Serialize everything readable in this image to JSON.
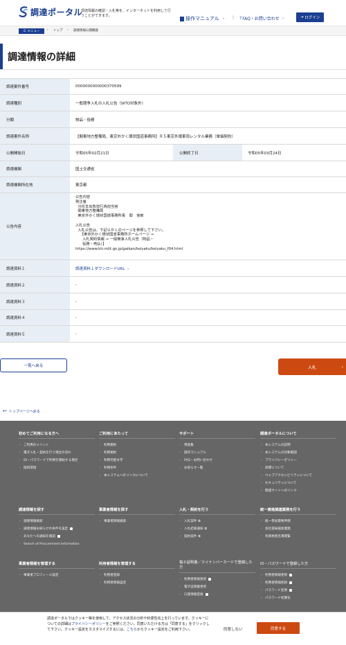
{
  "header": {
    "logo_text": "調達ポータル",
    "tagline": "調達情報の確認・入札等を、インターネットを利用して行うことができます。",
    "manual_link": "操作マニュアル",
    "faq_link": "FAQ・お問い合わせ",
    "login_label": "ログイン"
  },
  "breadcrumb": {
    "menu_label": "メニュー",
    "items": [
      "トップ",
      "調達情報公開機能"
    ]
  },
  "page_title": "調達情報の詳細",
  "detail": {
    "case_number_label": "調達案件番号",
    "case_number": "0000000000000370599",
    "type_label": "調達種別",
    "type": "一般競争入札の入札公告（WTO対象外）",
    "category_label": "分類",
    "category": "物品・役務",
    "name_label": "調達案件名称",
    "name": "【閲東地方整備局、東京外かく環状国道事務所】Ｒ５東京外環車両レンタル業務（単価契約）",
    "start_label": "公開開始日",
    "start": "令和05年02月21日",
    "end_label": "公開終了日",
    "end": "令和05年03月24日",
    "org_label": "調達機関",
    "org": "国土交通省",
    "location_label": "調達機関所在地",
    "location": "東京都",
    "content_label": "公告内容",
    "content": "公告内容\n発注者\n  分任支出負担行為担当官\n  関東地方整備局\n  東京外かく環状国道事務所長　関　信郎\n\n入札公告\n  入札公告は、下記ＵＲＬのページを参照して下さい。\n    【東京外かく環状国道事務所ホームページ →\n      入札契約情報 → 一般競争入札公告（物品・\n      役務・売払）】\nhttps://www.ktr.mlit.go.jp/gaikan/keiyaku/keiyaku_f04.html",
    "doc1_label": "調達資料１",
    "doc1": "調達資料１ダウンロードURL",
    "doc2_label": "調達資料２",
    "doc2": "-",
    "doc3_label": "調達資料３",
    "doc3": "-",
    "doc4_label": "調達資料４",
    "doc4": "-",
    "doc5_label": "調達資料５",
    "doc5": "-"
  },
  "actions": {
    "back_label": "一覧へ戻る",
    "bid_label": "入札",
    "top_link": "トップページへ戻る"
  },
  "footer": {
    "col1": {
      "head": "初めてご利用になる方へ",
      "items": [
        "ご利用のメリット",
        "電子入札・契約を行う場合の流れ",
        "ID・パスワードで利用を開始する場合",
        "接続環境"
      ]
    },
    "col2": {
      "head": "ご利用にあたって",
      "items": [
        "利用規約",
        "利用規約",
        "利用可能文字",
        "利用条件",
        "本システムへのリンクについて"
      ]
    },
    "col3": {
      "head": "サポート",
      "items": [
        "用語集",
        "操作マニュアル",
        "FAQ・お問い合わせ",
        "お知らせ一覧"
      ]
    },
    "col4": {
      "head": "調達ポータルについて",
      "items": [
        "本システムの説明",
        "本システムの対象範囲",
        "プライバシーポリシー",
        "商標について",
        "ウェブアクセシビリティについて",
        "セキュリティについて",
        "関連サイトへのリンク"
      ]
    },
    "col5": {
      "head": "調達情報を探す",
      "items": [
        "調達情報検索",
        "調達情報お知らせの条件を設定",
        "あなたへの通知を確認",
        "Search of Procurement Information"
      ]
    },
    "col6": {
      "head": "事業者情報を探す",
      "items": [
        "事業者情報検索"
      ]
    },
    "col7": {
      "head": "入札・契約を行う",
      "items": [
        "入札案件",
        "入札結果通知",
        "契約案件"
      ]
    },
    "col8": {
      "head": "統一資格関連業務を行う",
      "items": [
        "統一参加資格申請",
        "会社部局検索業務",
        "有資格者名簿閲覧"
      ]
    },
    "col9": {
      "head": "事業者情報を管理する",
      "items": [
        "事業者プロフィール設定"
      ]
    },
    "col10": {
      "head": "利用者情報を管理する",
      "items": [
        "利用者登録",
        "利用者情報設定"
      ]
    },
    "col11": {
      "head": "電子証明書／マイナンバーカードで登録した方",
      "items": [
        "利用者情報更新",
        "電子証明書更新",
        "口座情報登録"
      ]
    },
    "col12": {
      "head": "ID・パスワードで登録した方",
      "items": [
        "利用者情報更新",
        "利用者情報削除",
        "パスワード変更",
        "パスワード初期化"
      ]
    }
  },
  "cookie": {
    "text_before": "調達ポータルではクッキー等を使用して、アクセス状況の分析や利便性向上を行っています。クッキーについての詳細は",
    "policy_link": "プライバシーポリシー",
    "text_middle": "をご参照ください。同意いただける方は「同意する」をクリックして下さい。クッキー設定をカスタマイズするには、",
    "here_link": "こちら",
    "text_after": "からクッキー設定をご利用下さい。",
    "decline_label": "同意しない",
    "accept_label": "同意する"
  }
}
